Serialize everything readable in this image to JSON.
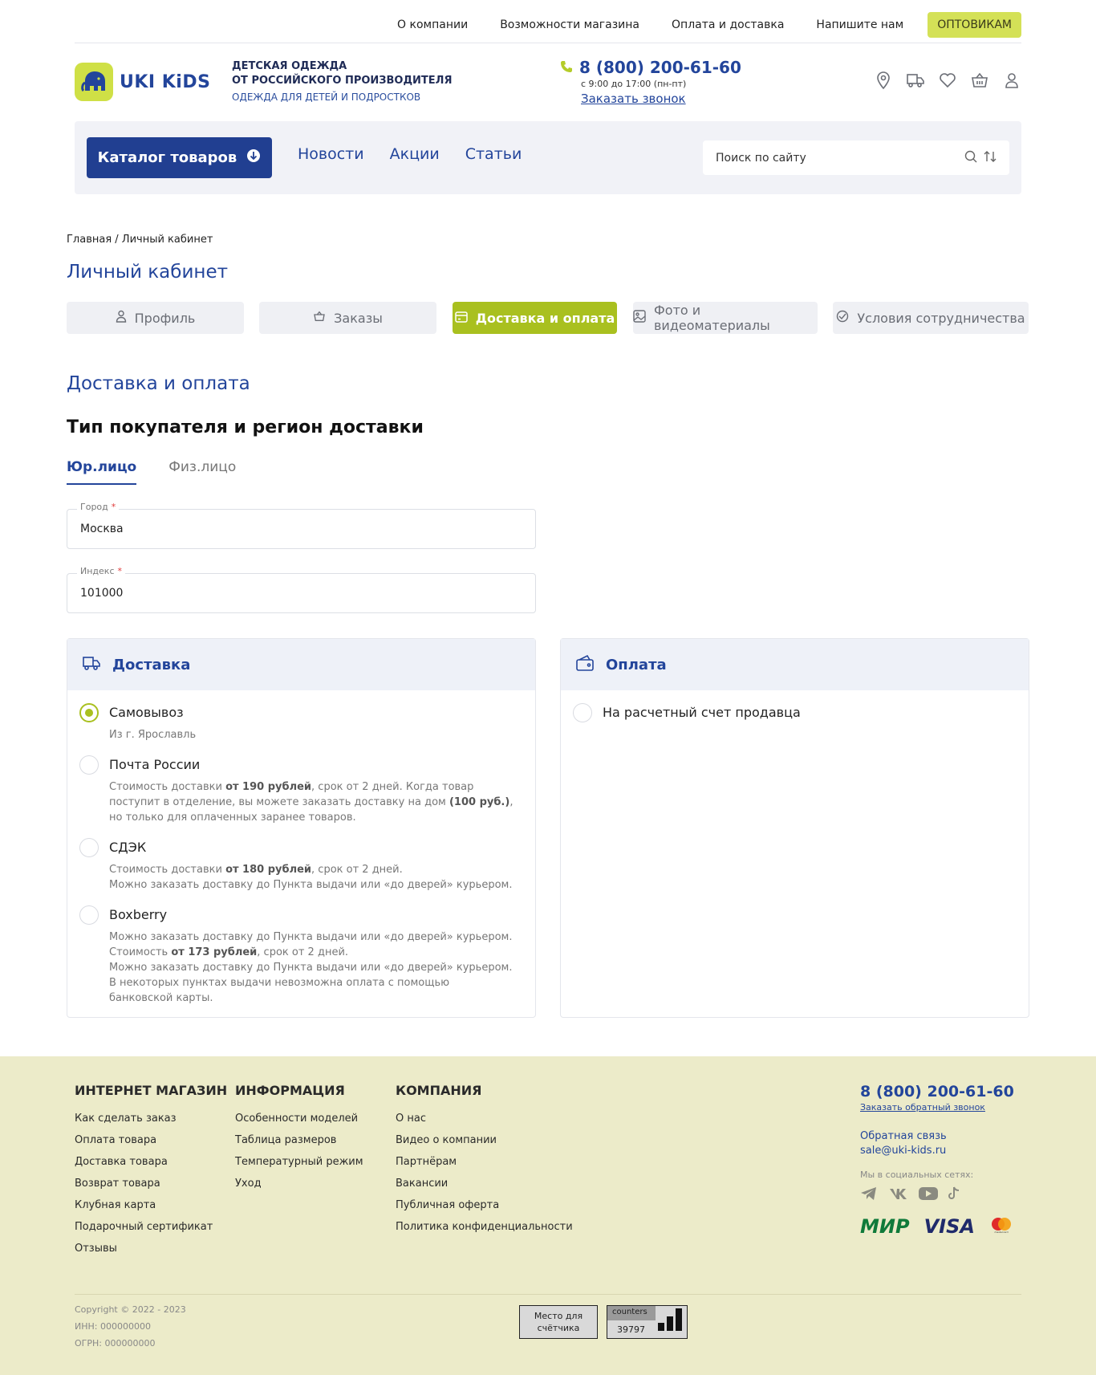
{
  "topnav": {
    "links": [
      "О компании",
      "Возможности магазина",
      "Оплата и доставка",
      "Напишите нам"
    ],
    "wholesale": "ОПТОВИКАМ"
  },
  "brand": {
    "name": "UKI KiDS",
    "tagline_line1": "ДЕТСКАЯ ОДЕЖДА",
    "tagline_line2": "ОТ РОССИЙСКОГО ПРОИЗВОДИТЕЛЯ",
    "tagline_sub": "ОДЕЖДА ДЛЯ ДЕТЕЙ И ПОДРОСТКОВ",
    "accent": "#23459b",
    "lime": "#a9c01f"
  },
  "contact": {
    "phone": "8 (800) 200-61-60",
    "hours": "с 9:00 до 17:00 (пн-пт)",
    "callback": "Заказать звонок"
  },
  "header_icons": [
    "location-icon",
    "truck-icon",
    "heart-icon",
    "basket-icon",
    "user-icon"
  ],
  "nav": {
    "catalog": "Каталог товаров",
    "links": [
      "Новости",
      "Акции",
      "Статьи"
    ],
    "search_placeholder": "Поиск по сайту"
  },
  "breadcrumb": "Главная / Личный кабинет",
  "page_title": "Личный кабинет",
  "account_tabs": [
    "Профиль",
    "Заказы",
    "Доставка и оплата",
    "Фото и видеоматериалы",
    "Условия сотрудничества"
  ],
  "section_title": "Доставка и оплата",
  "section_subtitle": "Тип покупателя и регион доставки",
  "buyer_tabs": [
    "Юр.лицо",
    "Физ.лицо"
  ],
  "fields": {
    "city_label": "Город",
    "city_value": "Москва",
    "index_label": "Индекс",
    "index_value": "101000",
    "required_mark": "*"
  },
  "delivery": {
    "title": "Доставка",
    "options": [
      {
        "name": "Самовывоз",
        "selected": true,
        "desc": "Из г. Ярославль"
      },
      {
        "name": "Почта России",
        "selected": false,
        "desc_a": "Стоимость доставки ",
        "desc_b": "от 190 рублей",
        "desc_c": ", срок от 2 дней. Когда товар поступит в отделение, вы можете заказать доставку на дом ",
        "desc_d": "(100 руб.)",
        "desc_e": ", но только для оплаченных заранее товаров."
      },
      {
        "name": "СДЭК",
        "selected": false,
        "desc_a": "Стоимость доставки ",
        "desc_b": "от 180 рублей",
        "desc_c": ", срок от 2 дней.",
        "desc_d": "Можно заказать доставку до Пункта выдачи или «до дверей» курьером."
      },
      {
        "name": "Boxberry",
        "selected": false,
        "desc_a": "Можно заказать доставку до Пункта выдачи или «до дверей» курьером.",
        "desc_b": "Стоимость ",
        "desc_c": "от 173 рублей",
        "desc_d": ", срок от 2 дней.",
        "desc_e": "Можно заказать доставку до Пункта выдачи или «до дверей» курьером.",
        "desc_f": "В некоторых пунктах выдачи невозможна оплата с помощью банковской карты."
      }
    ]
  },
  "payment": {
    "title": "Оплата",
    "options": [
      {
        "name": "На расчетный счет продавца",
        "selected": false
      }
    ]
  },
  "footer": {
    "col1": {
      "title": "ИНТЕРНЕТ МАГАЗИН",
      "links": [
        "Как сделать заказ",
        "Оплата товара",
        "Доставка товара",
        "Возврат товара",
        "Клубная карта",
        "Подарочный сертификат",
        "Отзывы"
      ]
    },
    "col2": {
      "title": "ИНФОРМАЦИЯ",
      "links": [
        "Особенности моделей",
        "Таблица размеров",
        "Температурный режим",
        "Уход"
      ]
    },
    "col3": {
      "title": "КОМПАНИЯ",
      "links": [
        "О нас",
        "Видео о компании",
        "Партнёрам",
        "Вакансии",
        "Публичная оферта",
        "Политика конфиденциальности"
      ]
    },
    "phone": "8 (800) 200-61-60",
    "callback": "Заказать обратный звонок",
    "feedback": "Обратная связь",
    "email": "sale@uki-kids.ru",
    "social_label": "Мы в социальных сетях:",
    "social_icons": [
      "telegram-icon",
      "vk-icon",
      "youtube-icon",
      "tiktok-icon"
    ],
    "payment_logos": [
      "МИР",
      "VISA",
      "mastercard"
    ],
    "copyright": "Copyright © 2022 - 2023",
    "inn": "ИНН: 000000000",
    "ogrn": "ОГРН: 000000000",
    "counter_placeholder_1": "Место для",
    "counter_placeholder_2": "счётчика",
    "counter_label": "counters",
    "counter_value": "39797"
  }
}
